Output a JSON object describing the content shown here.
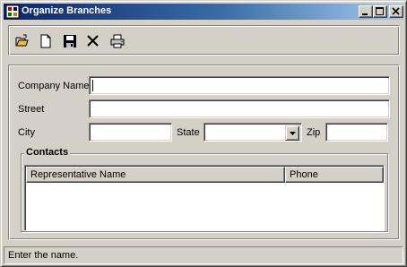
{
  "window": {
    "title": "Organize Branches"
  },
  "toolbar": {
    "buttons": [
      {
        "name": "open",
        "icon": "open-folder-icon"
      },
      {
        "name": "new",
        "icon": "new-document-icon"
      },
      {
        "name": "save",
        "icon": "save-disk-icon"
      },
      {
        "name": "delete",
        "icon": "delete-x-icon"
      },
      {
        "name": "print",
        "icon": "printer-icon"
      }
    ]
  },
  "form": {
    "company_name_label": "Company Name",
    "company_name_value": "",
    "street_label": "Street",
    "street_value": "",
    "city_label": "City",
    "city_value": "",
    "state_label": "State",
    "state_value": "",
    "zip_label": "Zip",
    "zip_value": ""
  },
  "contacts": {
    "title": "Contacts",
    "columns": [
      "Representative Name",
      "Phone"
    ],
    "rows": []
  },
  "status": {
    "text": "Enter the name."
  },
  "colors": {
    "title_gradient_start": "#0a246a",
    "title_gradient_end": "#a6caf0",
    "face": "#d4d0c8"
  }
}
